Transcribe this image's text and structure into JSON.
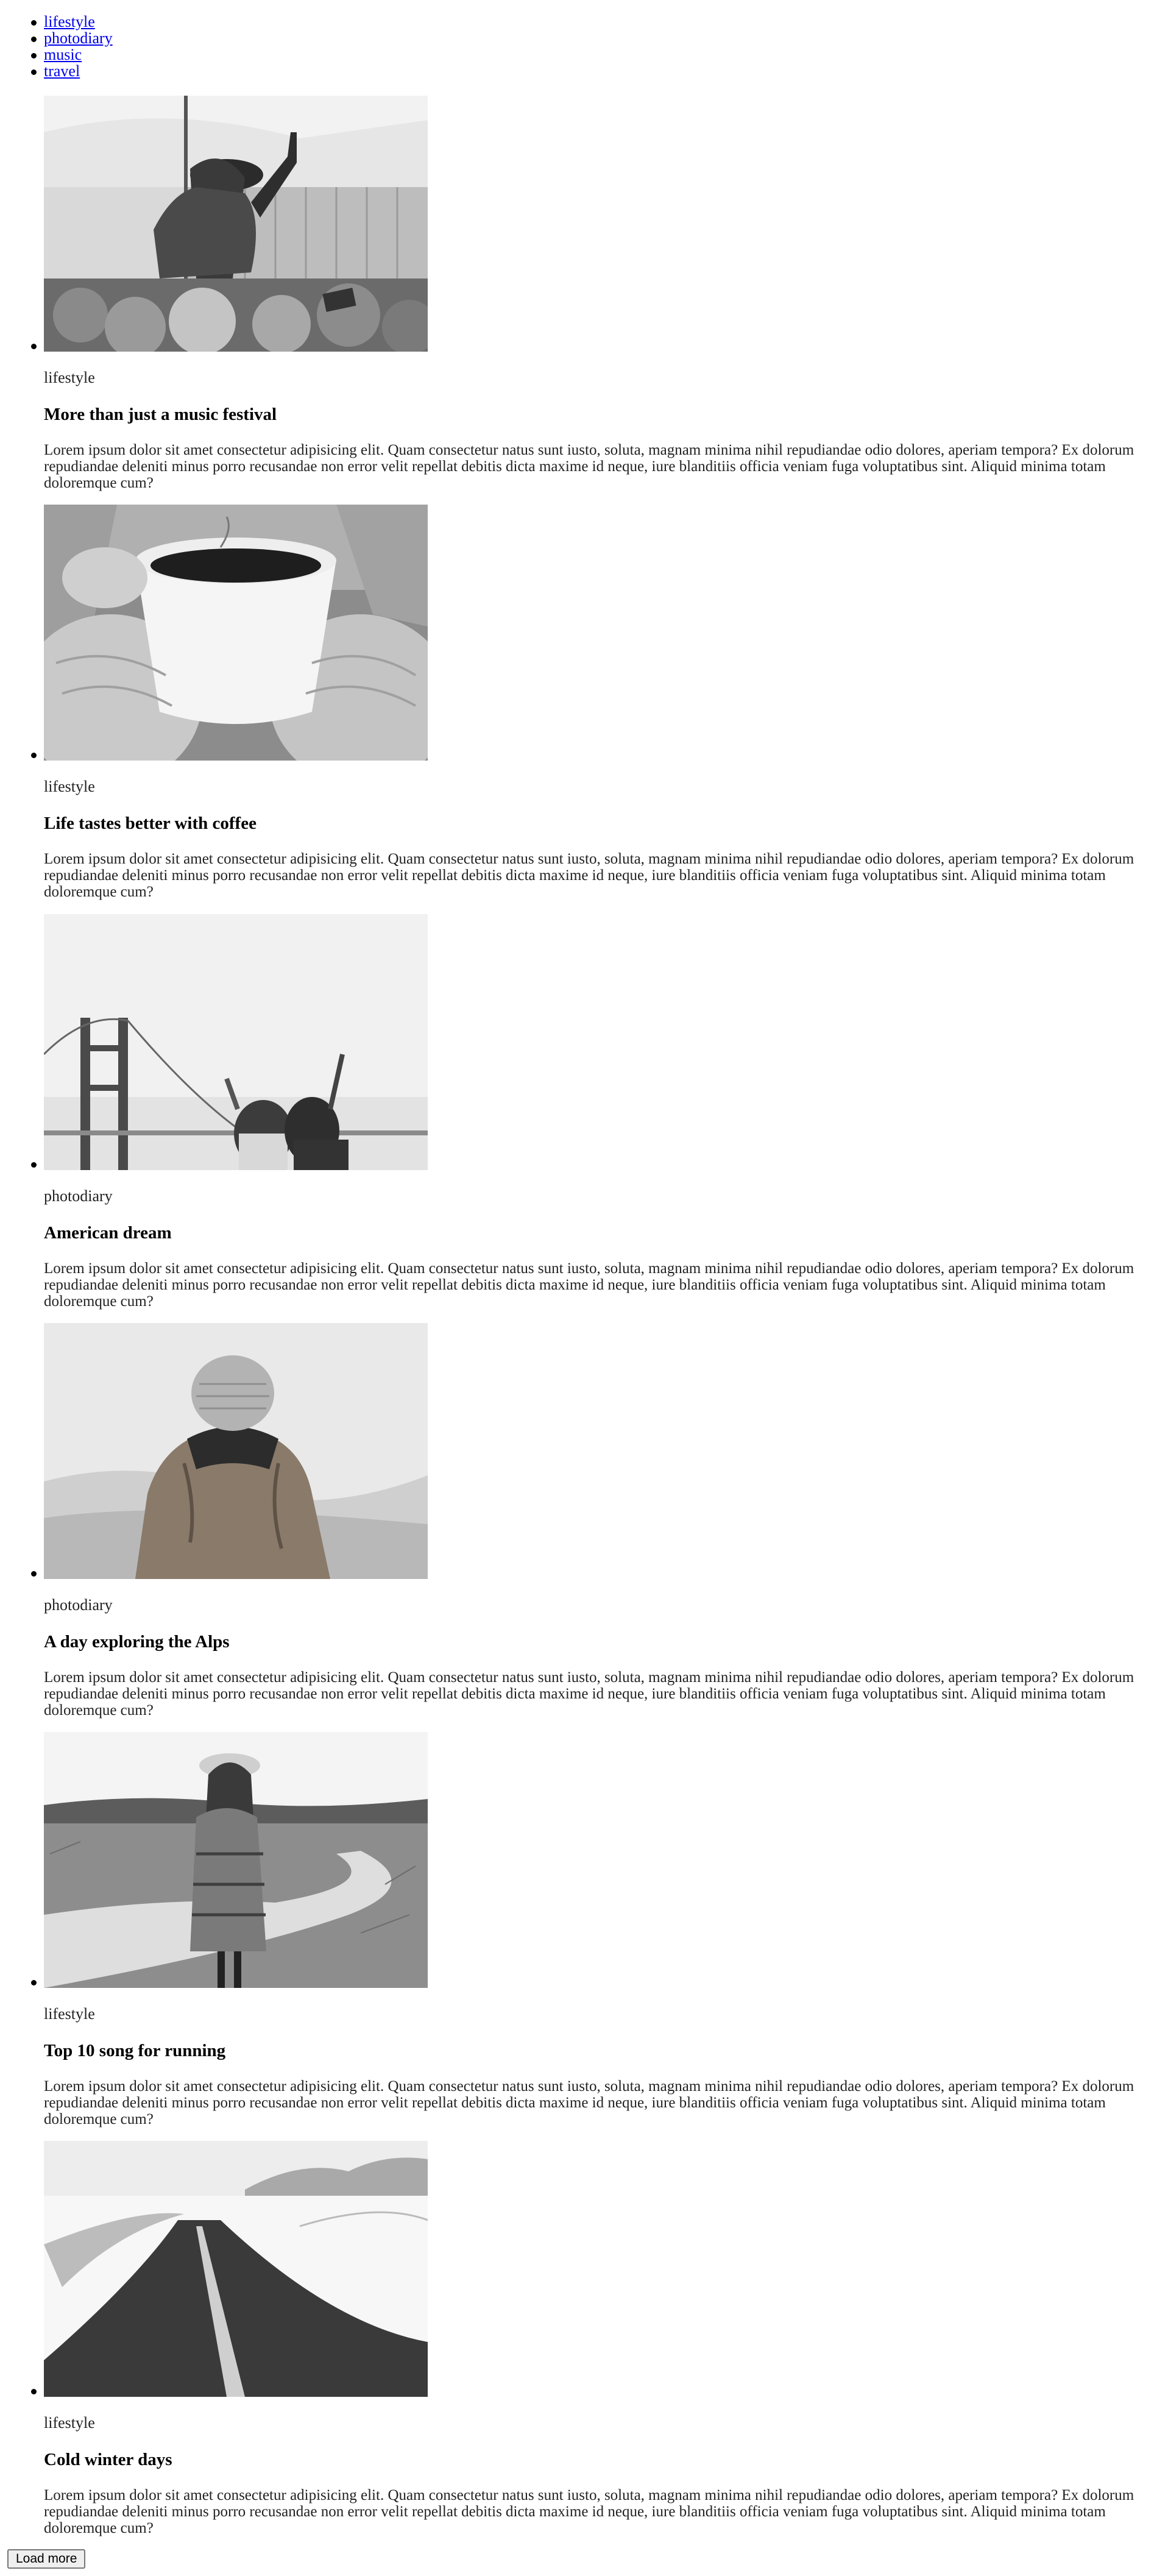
{
  "nav": {
    "items": [
      {
        "label": "lifestyle"
      },
      {
        "label": "photodiary"
      },
      {
        "label": "music"
      },
      {
        "label": "travel"
      }
    ]
  },
  "posts": [
    {
      "category": "lifestyle",
      "title": "More than just a music festival",
      "image_description_icon": "concert-photo",
      "excerpt": "Lorem ipsum dolor sit amet consectetur adipisicing elit. Quam consectetur natus sunt iusto, soluta, magnam minima nihil repudiandae odio dolores, aperiam tempora? Ex dolorum repudiandae deleniti minus porro recusandae non error velit repellat debitis dicta maxime id neque, iure blanditiis officia veniam fuga voluptatibus sint. Aliquid minima totam doloremque cum?"
    },
    {
      "category": "lifestyle",
      "title": "Life tastes better with coffee",
      "image_description_icon": "coffee-cup-photo",
      "excerpt": "Lorem ipsum dolor sit amet consectetur adipisicing elit. Quam consectetur natus sunt iusto, soluta, magnam minima nihil repudiandae odio dolores, aperiam tempora? Ex dolorum repudiandae deleniti minus porro recusandae non error velit repellat debitis dicta maxime id neque, iure blanditiis officia veniam fuga voluptatibus sint. Aliquid minima totam doloremque cum?"
    },
    {
      "category": "photodiary",
      "title": "American dream",
      "image_description_icon": "golden-gate-bridge-photo",
      "excerpt": "Lorem ipsum dolor sit amet consectetur adipisicing elit. Quam consectetur natus sunt iusto, soluta, magnam minima nihil repudiandae odio dolores, aperiam tempora? Ex dolorum repudiandae deleniti minus porro recusandae non error velit repellat debitis dicta maxime id neque, iure blanditiis officia veniam fuga voluptatibus sint. Aliquid minima totam doloremque cum?"
    },
    {
      "category": "photodiary",
      "title": "A day exploring the Alps",
      "image_description_icon": "hiker-in-fog-photo",
      "excerpt": "Lorem ipsum dolor sit amet consectetur adipisicing elit. Quam consectetur natus sunt iusto, soluta, magnam minima nihil repudiandae odio dolores, aperiam tempora? Ex dolorum repudiandae deleniti minus porro recusandae non error velit repellat debitis dicta maxime id neque, iure blanditiis officia veniam fuga voluptatibus sint. Aliquid minima totam doloremque cum?"
    },
    {
      "category": "lifestyle",
      "title": "Top 10 song for running",
      "image_description_icon": "woman-on-country-road-photo",
      "excerpt": "Lorem ipsum dolor sit amet consectetur adipisicing elit. Quam consectetur natus sunt iusto, soluta, magnam minima nihil repudiandae odio dolores, aperiam tempora? Ex dolorum repudiandae deleniti minus porro recusandae non error velit repellat debitis dicta maxime id neque, iure blanditiis officia veniam fuga voluptatibus sint. Aliquid minima totam doloremque cum?"
    },
    {
      "category": "lifestyle",
      "title": "Cold winter days",
      "image_description_icon": "snowy-road-photo",
      "excerpt": "Lorem ipsum dolor sit amet consectetur adipisicing elit. Quam consectetur natus sunt iusto, soluta, magnam minima nihil repudiandae odio dolores, aperiam tempora? Ex dolorum repudiandae deleniti minus porro recusandae non error velit repellat debitis dicta maxime id neque, iure blanditiis officia veniam fuga voluptatibus sint. Aliquid minima totam doloremque cum?"
    }
  ],
  "load_more": {
    "label": "Load more"
  },
  "colors": {
    "link": "#0000ee",
    "text": "#000000",
    "button_bg": "#efefef"
  }
}
